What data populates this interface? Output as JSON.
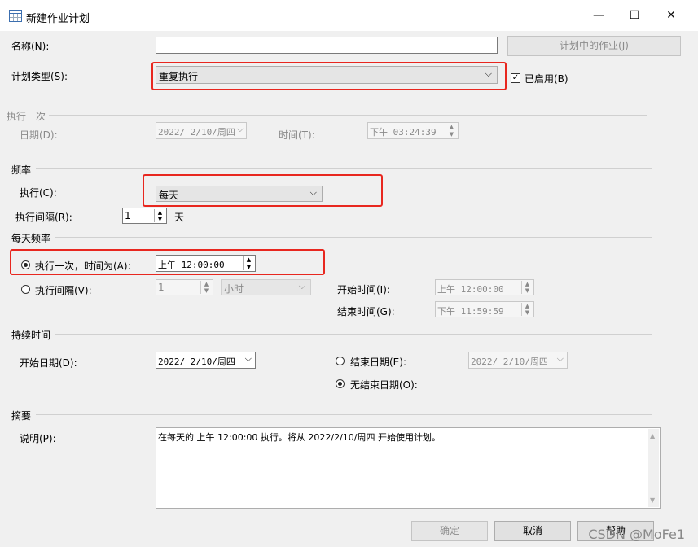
{
  "window": {
    "title": "新建作业计划",
    "minimize": "—",
    "maximize": "☐",
    "close": "✕"
  },
  "name": {
    "label": "名称(N):",
    "value": "",
    "jobs_button": "计划中的作业(J)"
  },
  "schedule_type": {
    "label": "计划类型(S):",
    "value": "重复执行",
    "enabled_label": "已启用(B)",
    "enabled": true
  },
  "once": {
    "section": "执行一次",
    "date_label": "日期(D):",
    "date_value": "2022/ 2/10/周四",
    "time_label": "时间(T):",
    "time_value": "下午 03:24:39"
  },
  "frequency": {
    "section": "频率",
    "occurs_label": "执行(C):",
    "occurs_value": "每天",
    "recurs_label": "执行间隔(R):",
    "recurs_value": "1",
    "recurs_unit": "天"
  },
  "daily": {
    "section": "每天频率",
    "once_label": "执行一次，时间为(A):",
    "once_value": "上午 12:00:00",
    "once_selected": true,
    "every_label": "执行间隔(V):",
    "every_value": "1",
    "every_unit": "小时",
    "start_label": "开始时间(I):",
    "start_value": "上午 12:00:00",
    "end_label": "结束时间(G):",
    "end_value": "下午 11:59:59"
  },
  "duration": {
    "section": "持续时间",
    "start_label": "开始日期(D):",
    "start_value": "2022/ 2/10/周四",
    "end_label": "结束日期(E):",
    "end_value": "2022/ 2/10/周四",
    "no_end_label": "无结束日期(O):",
    "no_end_selected": true
  },
  "summary": {
    "section": "摘要",
    "desc_label": "说明(P):",
    "desc_value": "在每天的 上午 12:00:00 执行。将从 2022/2/10/周四 开始使用计划。"
  },
  "buttons": {
    "ok": "确定",
    "cancel": "取消",
    "help": "帮助"
  },
  "watermark": "CSDN @MoFe1",
  "colors": {
    "highlight": "#e8271f",
    "background": "#f0f0f0"
  }
}
